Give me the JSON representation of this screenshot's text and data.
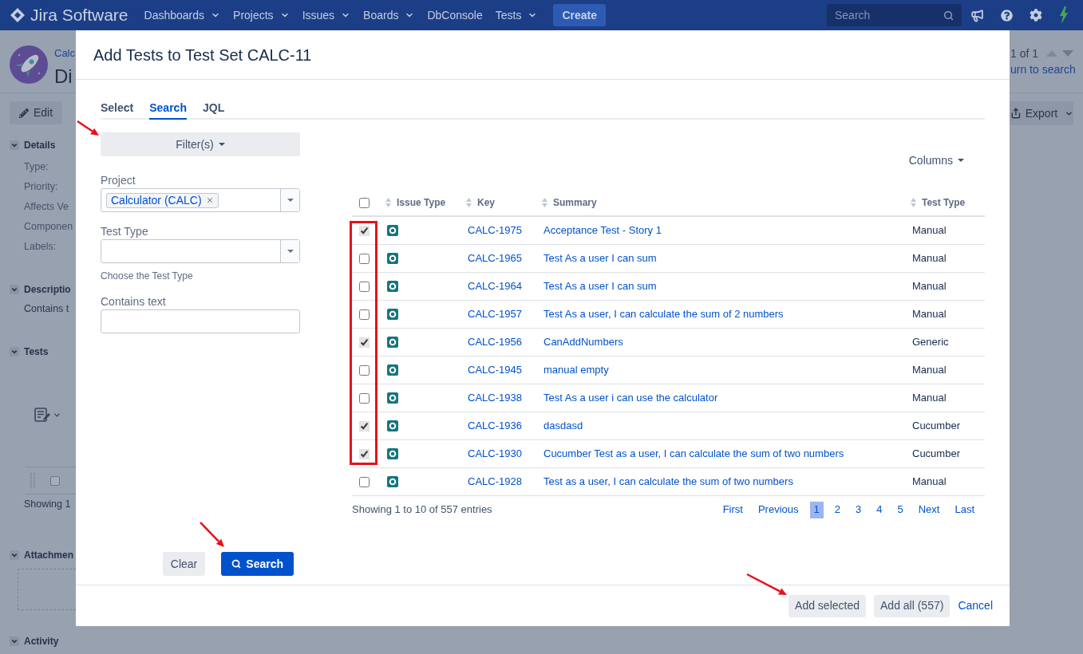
{
  "navbar": {
    "logo": "Jira Software",
    "menus": [
      {
        "label": "Dashboards",
        "dropdown": true
      },
      {
        "label": "Projects",
        "dropdown": true
      },
      {
        "label": "Issues",
        "dropdown": true
      },
      {
        "label": "Boards",
        "dropdown": true
      },
      {
        "label": "DbConsole",
        "dropdown": false
      },
      {
        "label": "Tests",
        "dropdown": true
      }
    ],
    "create_button": "Create",
    "search": {
      "placeholder": "Search"
    }
  },
  "issue_page": {
    "project_link": "Calc",
    "title": "Di",
    "edit_button": "Edit",
    "sections": [
      {
        "kind": "fields",
        "heading": "Details",
        "expanded": true,
        "lines": [
          "Type:",
          "Priority:",
          "Affects Ve",
          "Componen",
          "Labels:"
        ]
      },
      {
        "kind": "text",
        "heading": "Descriptio",
        "expanded": true,
        "lines": [
          "Contains t"
        ]
      },
      {
        "kind": "tests",
        "heading": "Tests",
        "expanded": true,
        "row_checked": false,
        "footer": "Showing 1"
      },
      {
        "kind": "attachments",
        "heading": "Attachmen",
        "expanded": true
      },
      {
        "kind": "plain",
        "heading": "Activity",
        "expanded": true
      }
    ],
    "pager": {
      "count": "1 of 1",
      "return_link": "urn to search"
    },
    "export_button": "Export"
  },
  "dialog": {
    "title": "Add Tests to Test Set CALC-11",
    "tabs": [
      {
        "label": "Select",
        "selected": false
      },
      {
        "label": "Search",
        "selected": true
      },
      {
        "label": "JQL",
        "selected": false
      }
    ],
    "filters_button": "Filter(s)",
    "fields": [
      {
        "kind": "multiselect",
        "label": "Project",
        "tags": [
          "Calculator (CALC)"
        ]
      },
      {
        "kind": "select",
        "label": "Test Type",
        "hint": "Choose the Test Type"
      },
      {
        "kind": "text",
        "label": "Contains text"
      }
    ],
    "clear_button": "Clear",
    "search_button": "Search",
    "columns_button": "Columns",
    "table": {
      "select_all": false,
      "columns": [
        "Issue Type",
        "Key",
        "Summary",
        "Test Type"
      ],
      "rows": [
        {
          "checked": true,
          "key": "CALC-1975",
          "summary": "Acceptance Test - Story 1",
          "test_type": "Manual"
        },
        {
          "checked": false,
          "key": "CALC-1965",
          "summary": "Test As a user I can sum",
          "test_type": "Manual"
        },
        {
          "checked": false,
          "key": "CALC-1964",
          "summary": "Test As a user I can sum",
          "test_type": "Manual"
        },
        {
          "checked": false,
          "key": "CALC-1957",
          "summary": "Test As a user, I can calculate the sum of 2 numbers",
          "test_type": "Manual"
        },
        {
          "checked": true,
          "key": "CALC-1956",
          "summary": "CanAddNumbers",
          "test_type": "Generic"
        },
        {
          "checked": false,
          "key": "CALC-1945",
          "summary": "manual empty",
          "test_type": "Manual"
        },
        {
          "checked": false,
          "key": "CALC-1938",
          "summary": "Test As a user i can use the calculator",
          "test_type": "Manual"
        },
        {
          "checked": true,
          "key": "CALC-1936",
          "summary": "dasdasd",
          "test_type": "Cucumber"
        },
        {
          "checked": true,
          "key": "CALC-1930",
          "summary": "Cucumber Test as a user, I can calculate the sum of two numbers",
          "test_type": "Cucumber"
        },
        {
          "checked": false,
          "key": "CALC-1928",
          "summary": "Test as a user, I can calculate the sum of two numbers",
          "test_type": "Manual"
        }
      ]
    },
    "info": "Showing 1 to 10 of 557 entries",
    "pagination": [
      {
        "label": "First",
        "selected": false
      },
      {
        "label": "Previous",
        "selected": false
      },
      {
        "label": "1",
        "selected": true
      },
      {
        "label": "2",
        "selected": false
      },
      {
        "label": "3",
        "selected": false
      },
      {
        "label": "4",
        "selected": false
      },
      {
        "label": "5",
        "selected": false
      },
      {
        "label": "Next",
        "selected": false
      },
      {
        "label": "Last",
        "selected": false
      }
    ],
    "footer": {
      "add_selected": "Add selected",
      "add_all": "Add all (557)",
      "cancel": "Cancel"
    }
  }
}
